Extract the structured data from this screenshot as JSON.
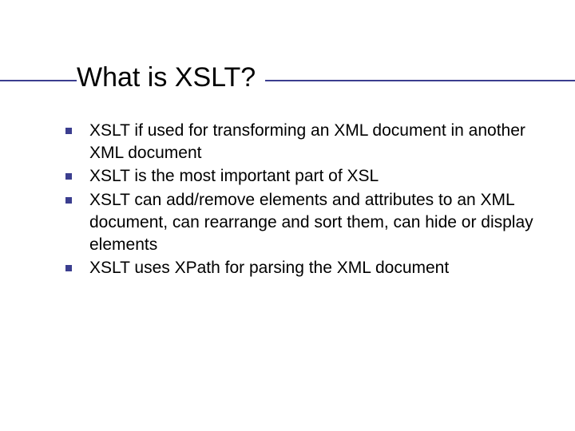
{
  "title": "What is XSLT?",
  "bullets": [
    "XSLT if used for transforming an XML document in another XML document",
    "XSLT is the most important part of XSL",
    "XSLT can add/remove elements and attributes to an XML document, can rearrange and sort them, can hide or display elements",
    "XSLT uses XPath for parsing the XML document"
  ],
  "colors": {
    "accent": "#3b3e8f"
  }
}
